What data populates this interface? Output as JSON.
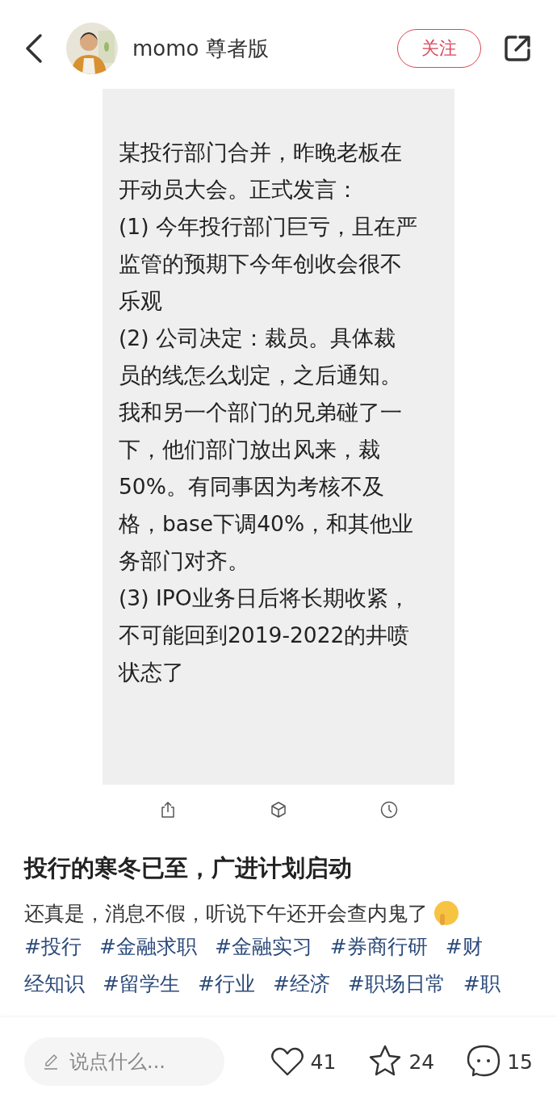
{
  "header": {
    "username": "momo 尊者版",
    "follow_button": "关注"
  },
  "image_text_lines": [
    "某投行部门合并，昨晚老板在",
    "开动员大会。正式发言：",
    "(1) 今年投行部门巨亏，且在严",
    "监管的预期下今年创收会很不",
    "乐观",
    "(2) 公司决定：裁员。具体裁",
    "员的线怎么划定，之后通知。",
    "我和另一个部门的兄弟碰了一",
    "下，他们部门放出风来，裁",
    "50%。有同事因为考核不及",
    "格，base下调40%，和其他业",
    "务部门对齐。",
    "(3) IPO业务日后将长期收紧，",
    "不可能回到2019-2022的井喷",
    "状态了"
  ],
  "post": {
    "title": "投行的寒冬已至，广进计划启动",
    "body": "还真是，消息不假，听说下午还开会查内鬼了",
    "tags": [
      "#投行",
      "#金融求职",
      "#金融实习",
      "#券商行研",
      "#财",
      "经知识",
      "#留学生",
      "#行业",
      "#经济",
      "#职场日常",
      "#职"
    ]
  },
  "bottom_bar": {
    "comment_placeholder": "说点什么...",
    "likes": "41",
    "favorites": "24",
    "comments": "15"
  }
}
